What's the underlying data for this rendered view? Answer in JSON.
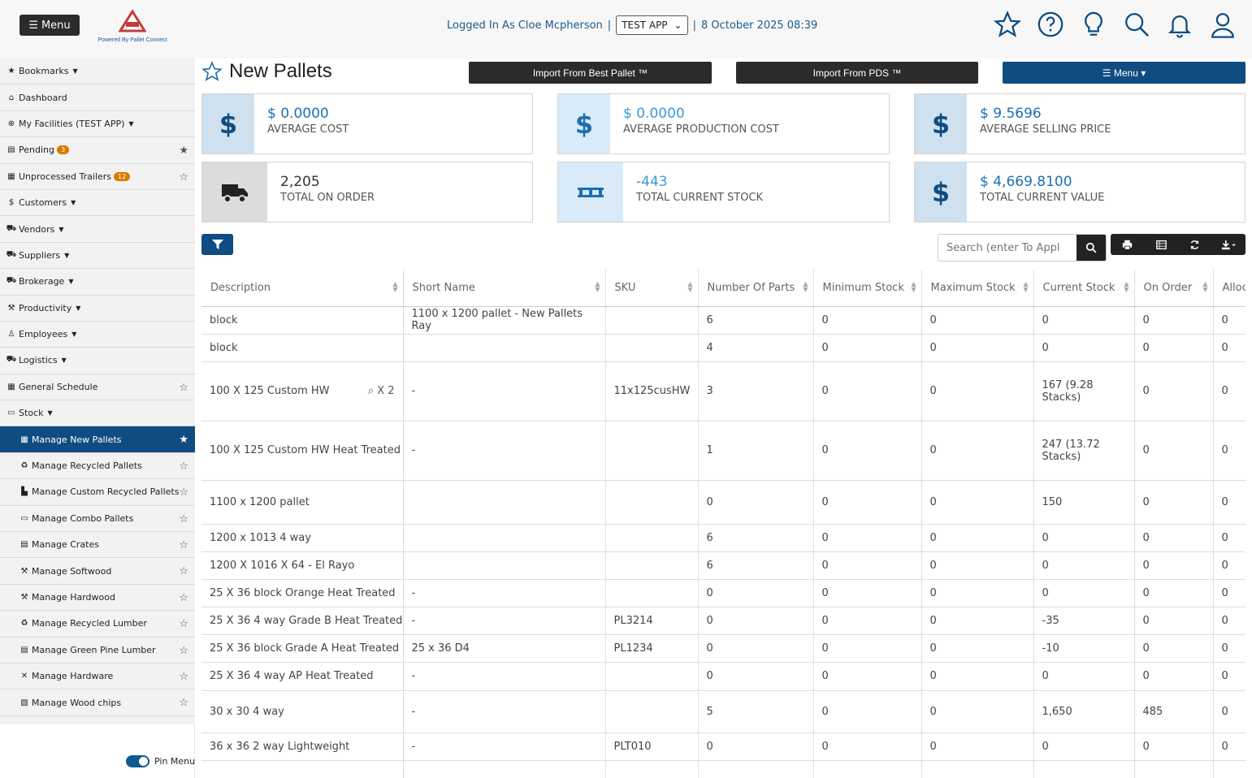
{
  "header": {
    "menu_label": "Menu",
    "logo_text": "PALLET CONNECT",
    "logo_sub": "TEST",
    "powered_by": "Powered By Pallet Connect",
    "logged_in": "Logged In As Cloe Mcpherson",
    "app_select": "TEST APP",
    "datetime": "8 October 2025 08:39",
    "icons": [
      "star-icon",
      "help-icon",
      "lightbulb-icon",
      "search-icon",
      "bell-icon",
      "user-icon"
    ]
  },
  "sidebar": {
    "items": [
      {
        "label": "Bookmarks",
        "icon": "star-icon",
        "caret": true,
        "star": false
      },
      {
        "label": "Dashboard",
        "icon": "home-icon",
        "caret": false,
        "star": false
      },
      {
        "label": "My Facilities (TEST APP)",
        "icon": "globe-icon",
        "caret": true,
        "star": false
      },
      {
        "label": "Pending",
        "icon": "clipboard-icon",
        "badge": "3",
        "star": "filled"
      },
      {
        "label": "Unprocessed Trailers",
        "icon": "trailer-icon",
        "badge": "12",
        "star": "outline"
      },
      {
        "label": "Customers",
        "icon": "dollar-icon",
        "caret": true
      },
      {
        "label": "Vendors",
        "icon": "truck-icon",
        "caret": true
      },
      {
        "label": "Suppliers",
        "icon": "truck-icon",
        "caret": true
      },
      {
        "label": "Brokerage",
        "icon": "truck-icon",
        "caret": true
      },
      {
        "label": "Productivity",
        "icon": "hammer-icon",
        "caret": true
      },
      {
        "label": "Employees",
        "icon": "person-icon",
        "caret": true
      },
      {
        "label": "Logistics",
        "icon": "truck-icon",
        "caret": true
      },
      {
        "label": "General Schedule",
        "icon": "calendar-icon",
        "star": "outline"
      },
      {
        "label": "Stock",
        "icon": "pallet-icon",
        "caret": true
      }
    ],
    "sub_items": [
      {
        "label": "Manage New Pallets",
        "icon": "pallets-icon",
        "active": true
      },
      {
        "label": "Manage Recycled Pallets",
        "icon": "recycle-icon"
      },
      {
        "label": "Manage Custom Recycled Pallets",
        "icon": "boot-icon"
      },
      {
        "label": "Manage Combo Pallets",
        "icon": "pallet-icon"
      },
      {
        "label": "Manage Crates",
        "icon": "crate-icon"
      },
      {
        "label": "Manage Softwood",
        "icon": "hammer-icon"
      },
      {
        "label": "Manage Hardwood",
        "icon": "hammer-icon"
      },
      {
        "label": "Manage Recycled Lumber",
        "icon": "recycle-icon"
      },
      {
        "label": "Manage Green Pine Lumber",
        "icon": "lumber-icon"
      },
      {
        "label": "Manage Hardware",
        "icon": "tools-icon"
      },
      {
        "label": "Manage Wood chips",
        "icon": "chips-icon"
      }
    ],
    "pin_label": "Pin Menu"
  },
  "page": {
    "title": "New Pallets",
    "btn_import_best": "Import From Best Pallet ™",
    "btn_import_pds": "Import From PDS ™",
    "btn_menu": "Menu"
  },
  "cards": [
    {
      "value": "$ 0.0000",
      "label": "AVERAGE COST",
      "icon": "dollar-icon"
    },
    {
      "value": "$ 0.0000",
      "label": "AVERAGE PRODUCTION COST",
      "icon": "dollar-icon"
    },
    {
      "value": "$ 9.5696",
      "label": "AVERAGE SELLING PRICE",
      "icon": "dollar-icon"
    },
    {
      "value": "2,205",
      "label": "TOTAL ON ORDER",
      "icon": "truck-icon"
    },
    {
      "value": "-443",
      "label": "TOTAL CURRENT STOCK",
      "icon": "pallet-icon"
    },
    {
      "value": "$ 4,669.8100",
      "label": "TOTAL CURRENT VALUE",
      "icon": "dollar-icon"
    }
  ],
  "search": {
    "placeholder": "Search (enter To Appl"
  },
  "table": {
    "columns": [
      "Description",
      "Short Name",
      "SKU",
      "Number Of Parts",
      "Minimum Stock",
      "Maximum Stock",
      "Current Stock",
      "On Order",
      "Alloc"
    ],
    "rows": [
      {
        "c": [
          "block",
          "1100 x 1200 pallet - New Pallets Ray",
          "",
          "6",
          "0",
          "0",
          "0",
          "0",
          "0"
        ],
        "h": 34
      },
      {
        "c": [
          "block",
          "",
          "",
          "4",
          "0",
          "0",
          "0",
          "0",
          "0"
        ],
        "h": 34
      },
      {
        "c": [
          "100 X 125 Custom HW",
          "-",
          "11x125cusHW",
          "3",
          "0",
          "0",
          "167 (9.28 Stacks)",
          "0",
          "0"
        ],
        "h": 73,
        "attach": "X 2"
      },
      {
        "c": [
          "100 X 125 Custom HW Heat Treated",
          "-",
          "",
          "1",
          "0",
          "0",
          "247 (13.72 Stacks)",
          "0",
          "0"
        ],
        "h": 73
      },
      {
        "c": [
          "1100 x 1200 pallet",
          "",
          "",
          "0",
          "0",
          "0",
          "150",
          "0",
          "0"
        ],
        "h": 54
      },
      {
        "c": [
          "1200 x 1013 4 way",
          "",
          "",
          "6",
          "0",
          "0",
          "0",
          "0",
          "0"
        ],
        "h": 34
      },
      {
        "c": [
          "1200 X 1016 X 64 - El Rayo",
          "",
          "",
          "6",
          "0",
          "0",
          "0",
          "0",
          "0"
        ],
        "h": 34
      },
      {
        "c": [
          "25 X 36 block Orange Heat Treated",
          "-",
          "",
          "0",
          "0",
          "0",
          "0",
          "0",
          "0"
        ],
        "h": 34
      },
      {
        "c": [
          "25 X 36 4 way Grade B Heat Treated",
          "-",
          "PL3214",
          "0",
          "0",
          "0",
          "-35",
          "0",
          "0"
        ],
        "h": 34
      },
      {
        "c": [
          "25 X 36 block Grade A Heat Treated",
          "25 x 36 D4",
          "PL1234",
          "0",
          "0",
          "0",
          "-10",
          "0",
          "0"
        ],
        "h": 34
      },
      {
        "c": [
          "25 X 36 4 way AP Heat Treated",
          "-",
          "",
          "0",
          "0",
          "0",
          "0",
          "0",
          "0"
        ],
        "h": 35
      },
      {
        "c": [
          "30 x 30 4 way",
          "-",
          "",
          "5",
          "0",
          "0",
          "1,650",
          "485",
          "0"
        ],
        "h": 52
      },
      {
        "c": [
          "36 x 36 2 way Lightweight",
          "-",
          "PLT010",
          "0",
          "0",
          "0",
          "0",
          "0",
          "0"
        ],
        "h": 34
      },
      {
        "c": [
          "",
          "",
          "",
          "",
          "",
          "",
          "",
          "",
          ""
        ],
        "h": 34
      }
    ]
  }
}
